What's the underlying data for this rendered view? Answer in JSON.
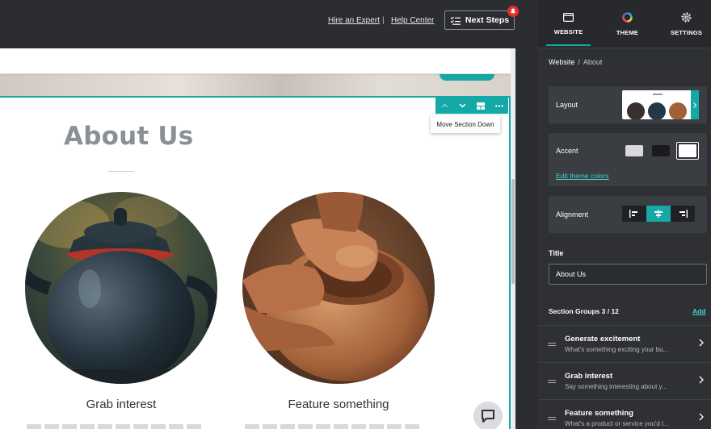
{
  "topbar": {
    "hire_expert": "Hire an Expert",
    "separator": "|",
    "help_center": "Help Center",
    "next_steps": "Next Steps"
  },
  "section": {
    "tooltip": "Move Section Down",
    "title": "About Us",
    "items": [
      {
        "caption": "Grab interest"
      },
      {
        "caption": "Feature something"
      }
    ]
  },
  "panel": {
    "tabs": [
      {
        "label": "WEBSITE",
        "icon": "browser-window-icon",
        "active": true
      },
      {
        "label": "THEME",
        "icon": "color-wheel-icon",
        "active": false
      },
      {
        "label": "SETTINGS",
        "icon": "gear-icon",
        "active": false
      }
    ],
    "breadcrumb": {
      "root": "Website",
      "separator": "/",
      "current": "About"
    },
    "layout_label": "Layout",
    "accent_label": "Accent",
    "accent_colors": [
      "#d9d9d9",
      "#1a1a1a",
      "#ffffff"
    ],
    "edit_theme_colors": "Edit theme colors",
    "alignment_label": "Alignment",
    "title_label": "Title",
    "title_value": "About Us",
    "section_groups_label": "Section Groups 3 / 12",
    "add_label": "Add",
    "groups": [
      {
        "title": "Generate excitement",
        "subtitle": "What's something exciting your bu..."
      },
      {
        "title": "Grab interest",
        "subtitle": "Say something interesting about y..."
      },
      {
        "title": "Feature something",
        "subtitle": "What's a product or service you'd l..."
      }
    ]
  },
  "colors": {
    "accent": "#14a8a6",
    "panel_bg": "#2e3034",
    "topbar_bg": "#2b2d30"
  }
}
